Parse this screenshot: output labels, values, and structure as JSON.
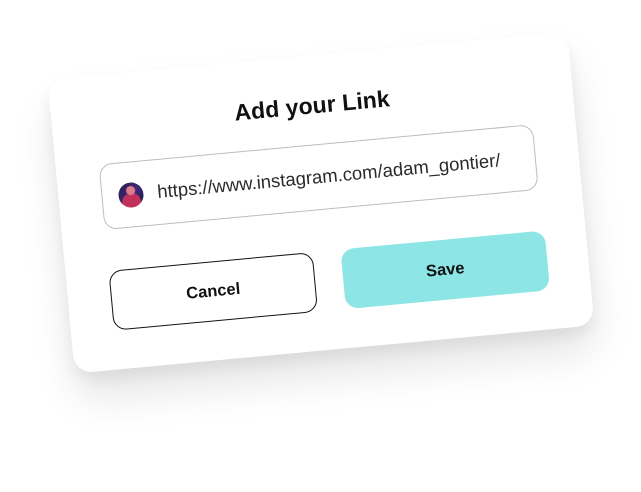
{
  "dialog": {
    "title": "Add your Link",
    "link_field": {
      "value": "https://www.instagram.com/adam_gontier/",
      "avatar_icon": "instagram-avatar"
    },
    "buttons": {
      "cancel_label": "Cancel",
      "save_label": "Save"
    }
  },
  "colors": {
    "save_button": "#8de5e6",
    "cancel_border": "#111111",
    "field_border": "#bdbdbd"
  }
}
